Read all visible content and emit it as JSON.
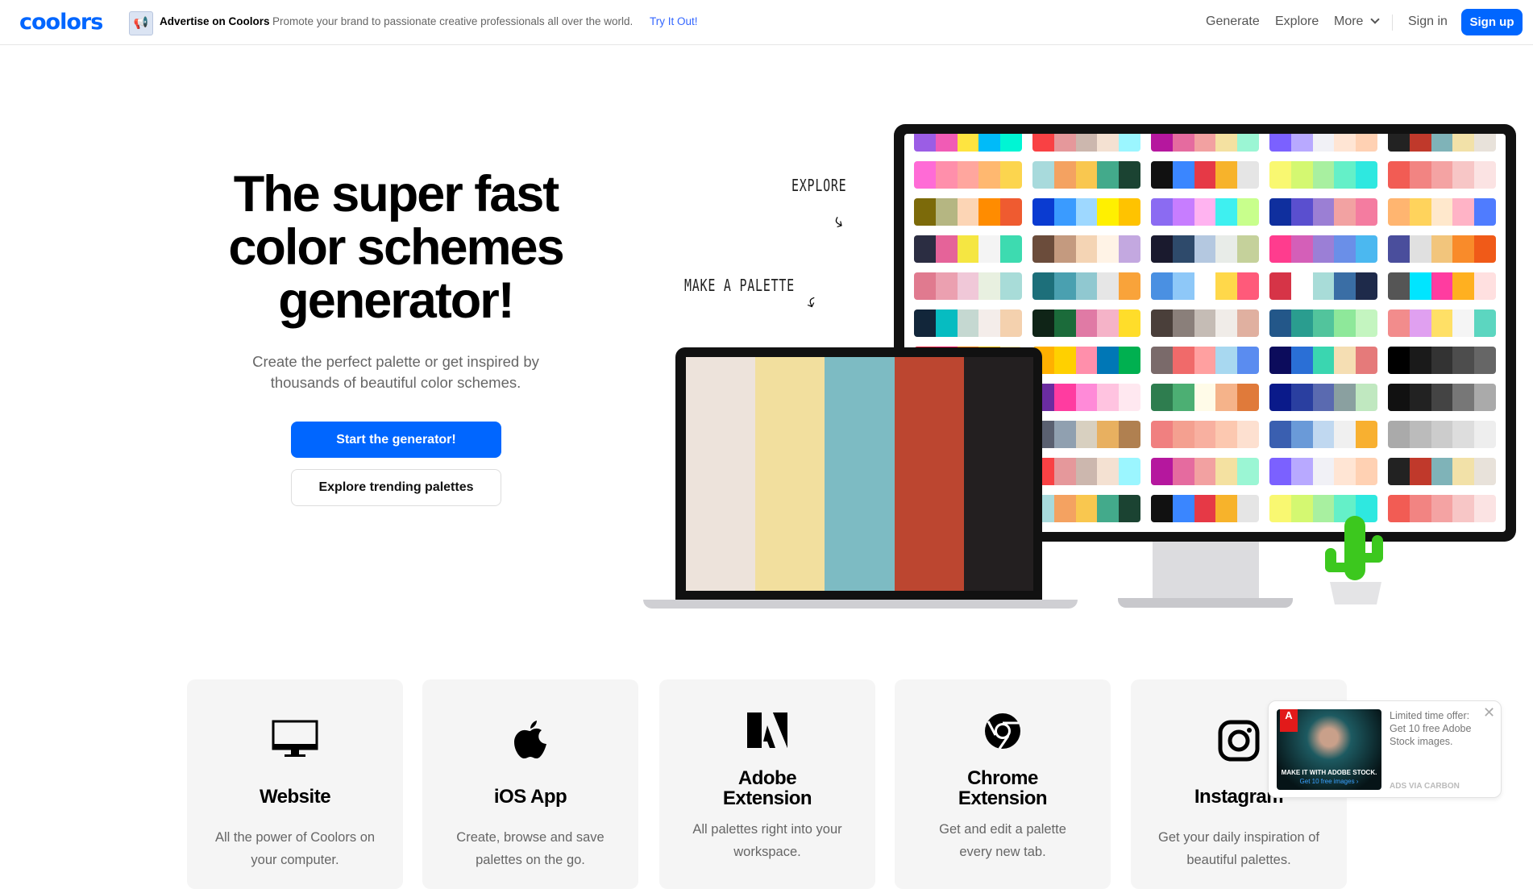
{
  "nav": {
    "logo": "coolors",
    "ad_icon": "megaphone-icon",
    "ad_title": "Advertise on Coolors",
    "ad_text": "Promote your brand to passionate creative professionals all over the world.",
    "ad_link": "Try It Out!",
    "links": [
      "Generate",
      "Explore",
      "More"
    ],
    "sign_in": "Sign in",
    "sign_up": "Sign up"
  },
  "hero": {
    "title": "The super fast color schemes generator!",
    "subtitle": "Create the perfect palette or get inspired by thousands of beautiful color schemes.",
    "start_button": "Start the generator!",
    "explore_button": "Explore trending palettes",
    "label_explore": "EXPLORE",
    "label_make": "MAKE A PALETTE"
  },
  "laptop_palette": [
    "#EDE3DB",
    "#F2DF9E",
    "#7DBBC3",
    "#BC4630",
    "#231F20"
  ],
  "grid_palettes": [
    [
      "#9b5de5",
      "#f15bb5",
      "#fee440",
      "#00bbf9",
      "#00f5d4"
    ],
    [
      "#f94144",
      "#e5989b",
      "#ccb7ae",
      "#f4e1d2",
      "#9bf6ff"
    ],
    [
      "#b5179e",
      "#e56b9f",
      "#f2a1a1",
      "#f4e1a1",
      "#9bf6d4"
    ],
    [
      "#7b61ff",
      "#b8a9ff",
      "#f1f1f6",
      "#ffe5d4",
      "#ffd1b3"
    ],
    [
      "#222222",
      "#c0392b",
      "#7fb3b8",
      "#f2e1a8",
      "#e8e2da"
    ],
    [
      "#ff6bd6",
      "#ff8fab",
      "#ffa69e",
      "#ffb870",
      "#fcd54e"
    ],
    [
      "#a8dadc",
      "#f4a261",
      "#f9c74f",
      "#43aa8b",
      "#1b4332"
    ],
    [
      "#111111",
      "#3a86ff",
      "#e63946",
      "#f7b32b",
      "#e5e5e5"
    ],
    [
      "#f9f871",
      "#d4f871",
      "#a8f0a0",
      "#64f0c8",
      "#2ee8e0"
    ],
    [
      "#f25c54",
      "#f28482",
      "#f4a3a3",
      "#f7c6c6",
      "#fbe3e3"
    ],
    [
      "#7c6a0a",
      "#b5b682",
      "#fcd5b5",
      "#ff8c00",
      "#ef5b30"
    ],
    [
      "#0a3bd1",
      "#3a9bff",
      "#9ed8ff",
      "#fff000",
      "#ffc300"
    ],
    [
      "#8b6bf2",
      "#c77dff",
      "#ffb3f0",
      "#3ef0f0",
      "#c8ff8c"
    ],
    [
      "#0f2f9e",
      "#5a4fcf",
      "#9b7fd4",
      "#f2a2a2",
      "#f47ca0"
    ],
    [
      "#ffb570",
      "#ffd35c",
      "#ffe8cc",
      "#ffb3c6",
      "#4f7cff"
    ],
    [
      "#2b2d42",
      "#e56399",
      "#f5e642",
      "#f4f4f4",
      "#3ddbb0"
    ],
    [
      "#6b4c3b",
      "#c49a7f",
      "#f4d4b4",
      "#fff3e6",
      "#c3a8e0"
    ],
    [
      "#1a1a2e",
      "#2e4a6b",
      "#b4c8e0",
      "#e8ece8",
      "#c5d19b"
    ],
    [
      "#ff3c8e",
      "#d45fb8",
      "#9b7fd6",
      "#6a8fe8",
      "#4bb8f0"
    ],
    [
      "#4a4e9c",
      "#e0e0e0",
      "#f2c57c",
      "#f98b2a",
      "#f05a18"
    ],
    [
      "#e07a8f",
      "#eba0b0",
      "#f0c8d8",
      "#e8f0e0",
      "#a8dcd8"
    ],
    [
      "#1d6f7a",
      "#4aa0b0",
      "#90c8d0",
      "#e6e6e6",
      "#f9a33a"
    ],
    [
      "#4a90e2",
      "#8ec8f8",
      "#ffffff",
      "#ffd84a",
      "#ff5a7a"
    ],
    [
      "#d63447",
      "#ffffff",
      "#a8dcd8",
      "#3a6ea5",
      "#1e2a4a"
    ],
    [
      "#555555",
      "#00e5ff",
      "#ff3ca0",
      "#ffb020",
      "#ffe0e0"
    ],
    [
      "#12263a",
      "#06bcc1",
      "#c5d8d1",
      "#f4edea",
      "#f4d1ae"
    ],
    [
      "#0f2417",
      "#1b6b3a",
      "#e07aa5",
      "#f5b3c8",
      "#ffdd2a"
    ],
    [
      "#4a3f3a",
      "#8a7f7a",
      "#c5bcb5",
      "#f0ece8",
      "#e0b0a0"
    ],
    [
      "#235789",
      "#2a9d8f",
      "#52c49c",
      "#8ee89a",
      "#c4f5c0"
    ],
    [
      "#f28c8c",
      "#e0a0f0",
      "#ffe066",
      "#f5f5f5",
      "#5cd6c0"
    ],
    [
      "#e01e37",
      "#ff0a54",
      "#ff7b00",
      "#ffbe0b",
      "#ffe8a8"
    ],
    [
      "#ffb000",
      "#ffd000",
      "#ff8fab",
      "#0077b6",
      "#00b050"
    ],
    [
      "#7a6a6a",
      "#f06a6a",
      "#ffa0a0",
      "#a8d8f0",
      "#5a8cf0"
    ],
    [
      "#0c0c5c",
      "#2a6fd6",
      "#3ad6b0",
      "#f5deb3",
      "#e57a7a"
    ],
    [
      "#000000",
      "#1a1a1a",
      "#333333",
      "#4d4d4d",
      "#666666"
    ],
    [
      "#1e9e6a",
      "#ffd500",
      "#ff9000",
      "#ff5a1f",
      "#f0003c"
    ],
    [
      "#6a2ca0",
      "#ff3ca0",
      "#ff8ad8",
      "#ffc3e0",
      "#ffe8f0"
    ],
    [
      "#2e7d4f",
      "#4caf73",
      "#fffbe8",
      "#f5b38a",
      "#e07a3a"
    ],
    [
      "#0a1a8a",
      "#2a3fa0",
      "#5a6ab0",
      "#8aa0a0",
      "#c0e8c0"
    ],
    [
      "#111111",
      "#222222",
      "#444444",
      "#777777",
      "#aaaaaa"
    ],
    [
      "#5a4f8a",
      "#9a90c0",
      "#b8c8e0",
      "#d8f0f0",
      "#d8d0a0"
    ],
    [
      "#5a6070",
      "#90a0b0",
      "#d8d0c0",
      "#e8b060",
      "#b08050"
    ],
    [
      "#f08080",
      "#f4a090",
      "#f8b0a0",
      "#fcc8b0",
      "#fde0d0"
    ],
    [
      "#3a5fb0",
      "#6a9ad8",
      "#c0d8f0",
      "#f0f0f0",
      "#f8b030"
    ],
    [
      "#aaaaaa",
      "#bbbbbb",
      "#cccccc",
      "#dddddd",
      "#eeeeee"
    ]
  ],
  "cards": [
    {
      "icon": "monitor-icon",
      "title": "Website",
      "text": "All the power of Coolors on your computer."
    },
    {
      "icon": "apple-icon",
      "title": "iOS App",
      "text": "Create, browse and save palettes on the go."
    },
    {
      "icon": "adobe-icon",
      "title": "Adobe Extension",
      "text": "All palettes right into your workspace."
    },
    {
      "icon": "chrome-icon",
      "title": "Chrome Extension",
      "text": "Get and edit a palette every new tab."
    },
    {
      "icon": "instagram-icon",
      "title": "Instagram",
      "text": "Get your daily inspiration of beautiful palettes."
    }
  ],
  "carbon": {
    "brand": "Adobe",
    "image_headline": "MAKE IT WITH ADOBE STOCK.",
    "image_cta": "Get 10 free images ›",
    "text": "Limited time offer: Get 10 free Adobe Stock images.",
    "via": "ADS VIA CARBON",
    "close": "✕"
  }
}
